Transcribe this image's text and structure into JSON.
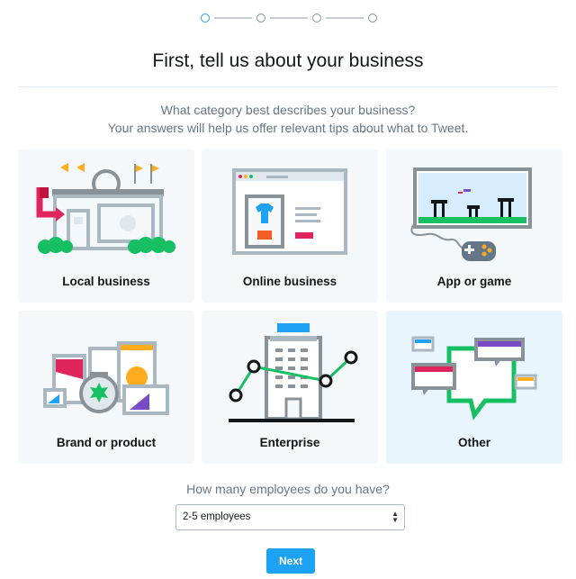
{
  "stepper": {
    "total": 4,
    "current": 1
  },
  "header": {
    "title": "First, tell us about your business"
  },
  "intro": {
    "question": "What category best describes your business?",
    "subtext": "Your answers will help us offer relevant tips about what to Tweet."
  },
  "categories": [
    {
      "label": "Local business",
      "icon": "storefront-icon",
      "selected": false
    },
    {
      "label": "Online business",
      "icon": "web-store-icon",
      "selected": false
    },
    {
      "label": "App or game",
      "icon": "game-controller-icon",
      "selected": false
    },
    {
      "label": "Brand or product",
      "icon": "products-icon",
      "selected": false
    },
    {
      "label": "Enterprise",
      "icon": "office-building-icon",
      "selected": false
    },
    {
      "label": "Other",
      "icon": "speech-bubbles-icon",
      "selected": true
    }
  ],
  "employees": {
    "question": "How many employees do you have?",
    "selected": "2-5 employees"
  },
  "actions": {
    "next_label": "Next"
  },
  "colors": {
    "accent": "#1da1f2",
    "card_bg": "#f5f8fa",
    "card_selected_bg": "#e8f5fd"
  }
}
